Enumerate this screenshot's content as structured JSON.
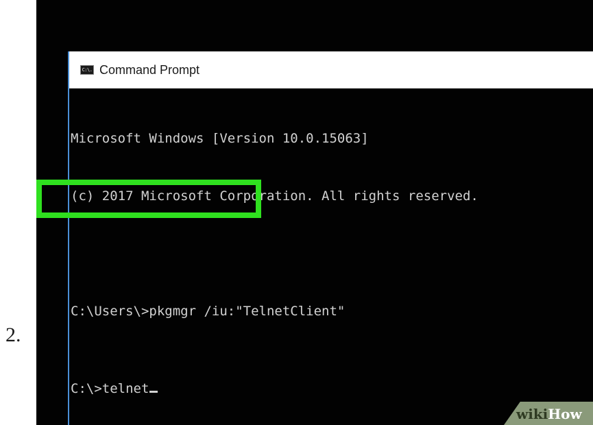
{
  "step": {
    "number": "2."
  },
  "window": {
    "title": "Command Prompt",
    "icon": "cmd-icon",
    "icon_text": "C:\\."
  },
  "console": {
    "lines": [
      "Microsoft Windows [Version 10.0.15063]",
      "(c) 2017 Microsoft Corporation. All rights reserved.",
      "",
      "C:\\Users\\>pkgmgr /iu:\"TelnetClient\"",
      "C:\\>telnet"
    ]
  },
  "highlight": {
    "color": "#2fe01f"
  },
  "watermark": {
    "part1": "wiki",
    "part2": "How"
  },
  "colors": {
    "console_bg": "#020202",
    "console_text": "#d2d2d2",
    "title_bar": "#ffffff",
    "window_edge": "#4a8fd6"
  }
}
